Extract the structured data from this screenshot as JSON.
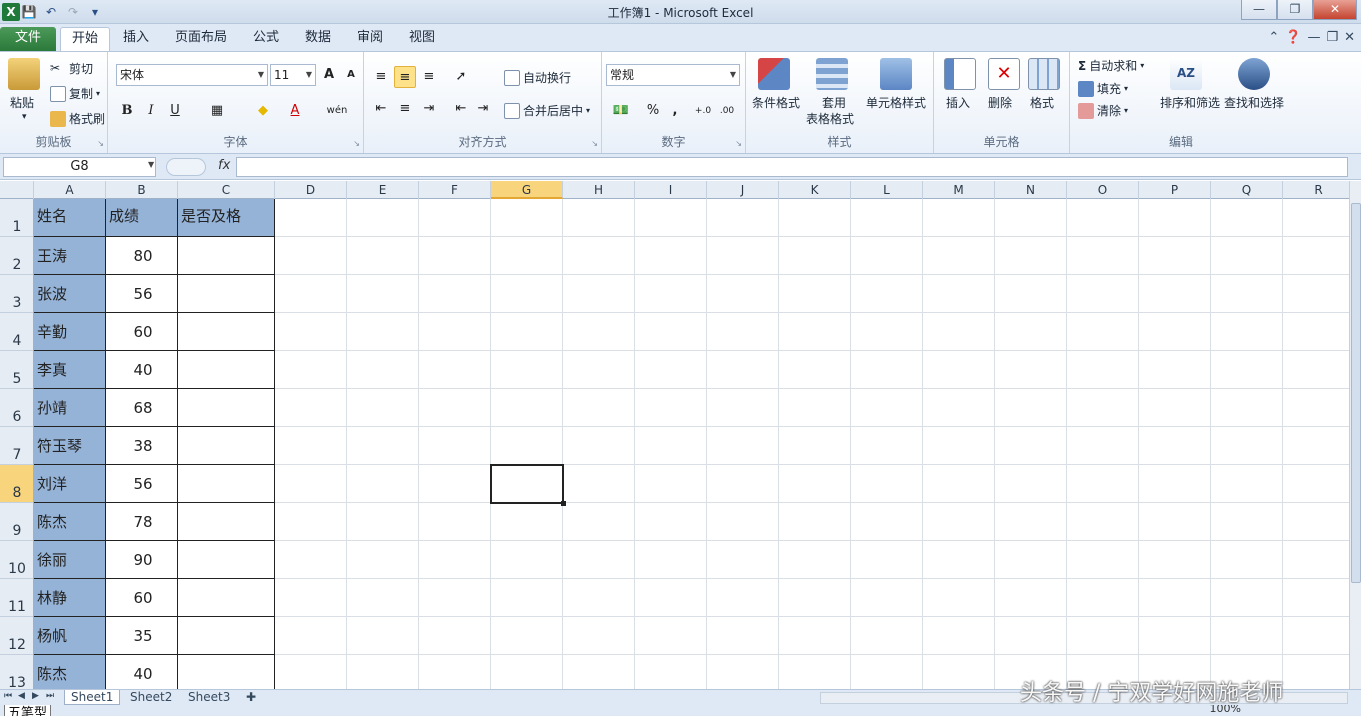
{
  "window": {
    "title": "工作簿1 - Microsoft Excel",
    "app_icon": "X"
  },
  "ribbon_tabs": [
    {
      "label": "文件"
    },
    {
      "label": "开始"
    },
    {
      "label": "插入"
    },
    {
      "label": "页面布局"
    },
    {
      "label": "公式"
    },
    {
      "label": "数据"
    },
    {
      "label": "审阅"
    },
    {
      "label": "视图"
    }
  ],
  "active_tab": "开始",
  "clipboard": {
    "paste": "粘贴",
    "cut": "剪切",
    "copy": "复制",
    "format_painter": "格式刷",
    "group": "剪贴板"
  },
  "font": {
    "name": "宋体",
    "size": "11",
    "group": "字体",
    "bold": "B",
    "italic": "I",
    "underline": "U",
    "grow": "A",
    "shrink": "A",
    "font_color": "A",
    "wen": "wén"
  },
  "alignment": {
    "wrap": "自动换行",
    "merge": "合并后居中",
    "group": "对齐方式"
  },
  "number": {
    "format": "常规",
    "percent": "%",
    "comma": ",",
    "inc": "+.0",
    "dec": ".00",
    "group": "数字"
  },
  "styles": {
    "conditional": "条件格式",
    "table_1": "套用",
    "table_2": "表格格式",
    "cell_styles": "单元格样式",
    "group": "样式"
  },
  "cells_group": {
    "insert": "插入",
    "delete": "删除",
    "format": "格式",
    "group": "单元格"
  },
  "editing": {
    "autosum": "自动求和",
    "fill": "填充",
    "clear": "清除",
    "sort": "排序和筛选",
    "find": "查找和选择",
    "group": "编辑",
    "sigma": "Σ"
  },
  "formula_bar": {
    "name_box": "G8",
    "fx": "fx",
    "content": ""
  },
  "columns": [
    "A",
    "B",
    "C",
    "D",
    "E",
    "F",
    "G",
    "H",
    "I",
    "J",
    "K",
    "L",
    "M",
    "N",
    "O",
    "P",
    "Q",
    "R"
  ],
  "selected_column": "G",
  "rows": [
    "1",
    "2",
    "3",
    "4",
    "5",
    "6",
    "7",
    "8",
    "9",
    "10",
    "11",
    "12",
    "13"
  ],
  "selected_row": "8",
  "table": {
    "headers": [
      "姓名",
      "成绩",
      "是否及格"
    ],
    "records": [
      {
        "name": "王涛",
        "score": "80"
      },
      {
        "name": "张波",
        "score": "56"
      },
      {
        "name": "辛勤",
        "score": "60"
      },
      {
        "name": "李真",
        "score": "40"
      },
      {
        "name": "孙靖",
        "score": "68"
      },
      {
        "name": "符玉琴",
        "score": "38"
      },
      {
        "name": "刘洋",
        "score": "56"
      },
      {
        "name": "陈杰",
        "score": "78"
      },
      {
        "name": "徐丽",
        "score": "90"
      },
      {
        "name": "林静",
        "score": "60"
      },
      {
        "name": "杨帆",
        "score": "35"
      },
      {
        "name": "陈杰",
        "score": "40"
      }
    ]
  },
  "sheets": [
    {
      "label": "Sheet1"
    },
    {
      "label": "Sheet2"
    },
    {
      "label": "Sheet3"
    }
  ],
  "active_sheet": "Sheet1",
  "status": {
    "ime": "五笔型",
    "zoom": "100%"
  },
  "watermark": "头条号 / 宁双学好网施老师",
  "colors": {
    "name_fill": "#95b3d7",
    "accent_green": "#2c7a3b",
    "selected_header": "#f8d57d"
  }
}
